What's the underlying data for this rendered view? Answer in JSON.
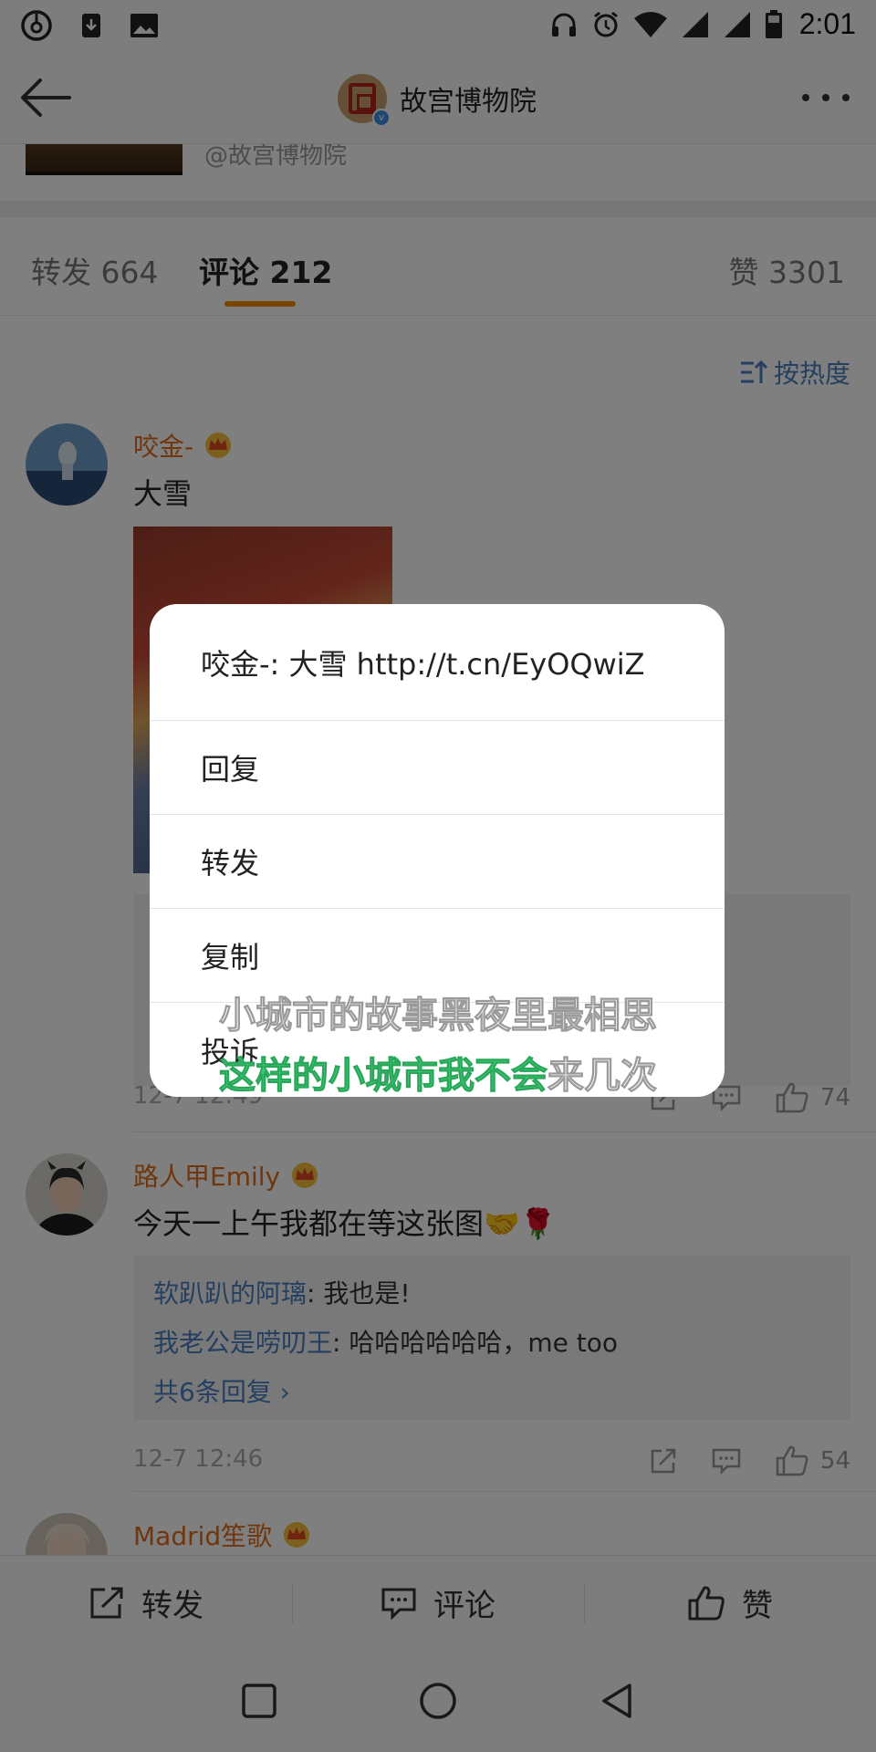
{
  "status_bar": {
    "time": "2:01"
  },
  "nav": {
    "title": "故宫博物院",
    "verified_badge": "v"
  },
  "post": {
    "handle": "@故宫博物院"
  },
  "tabs": {
    "repost": "转发 664",
    "comments": "评论 212",
    "likes": "赞 3301"
  },
  "sort": {
    "label": "按热度"
  },
  "comments": [
    {
      "name": "咬金-",
      "text": "大雪",
      "time": "12-7 12:49",
      "likes": "74"
    },
    {
      "name": "路人甲Emily",
      "text": "今天一上午我都在等这张图🤝🌹",
      "replies": [
        {
          "user": "软趴趴的阿璃",
          "text": ": 我也是!"
        },
        {
          "user": "我老公是唠叨王",
          "text": ": 哈哈哈哈哈哈，me too"
        }
      ],
      "more_replies": "共6条回复 ›",
      "time": "12-7 12:46",
      "likes": "54"
    },
    {
      "name": "Madrid笙歌"
    }
  ],
  "bottom_bar": {
    "repost": "转发",
    "comment": "评论",
    "like": "赞"
  },
  "menu": {
    "header": "咬金-: 大雪 http://t.cn/EyOQwiZ",
    "items": [
      "回复",
      "转发",
      "复制",
      "投诉"
    ]
  },
  "lyrics": {
    "line1": "小城市的故事黑夜里最相思",
    "line2_sung": "这样的小城市我不会",
    "line2_rest": "来几次"
  },
  "colors": {
    "accent": "#f08c00",
    "username": "#e06c1b",
    "link": "#4a7fc0",
    "lyric_highlight": "#3ecf73"
  }
}
